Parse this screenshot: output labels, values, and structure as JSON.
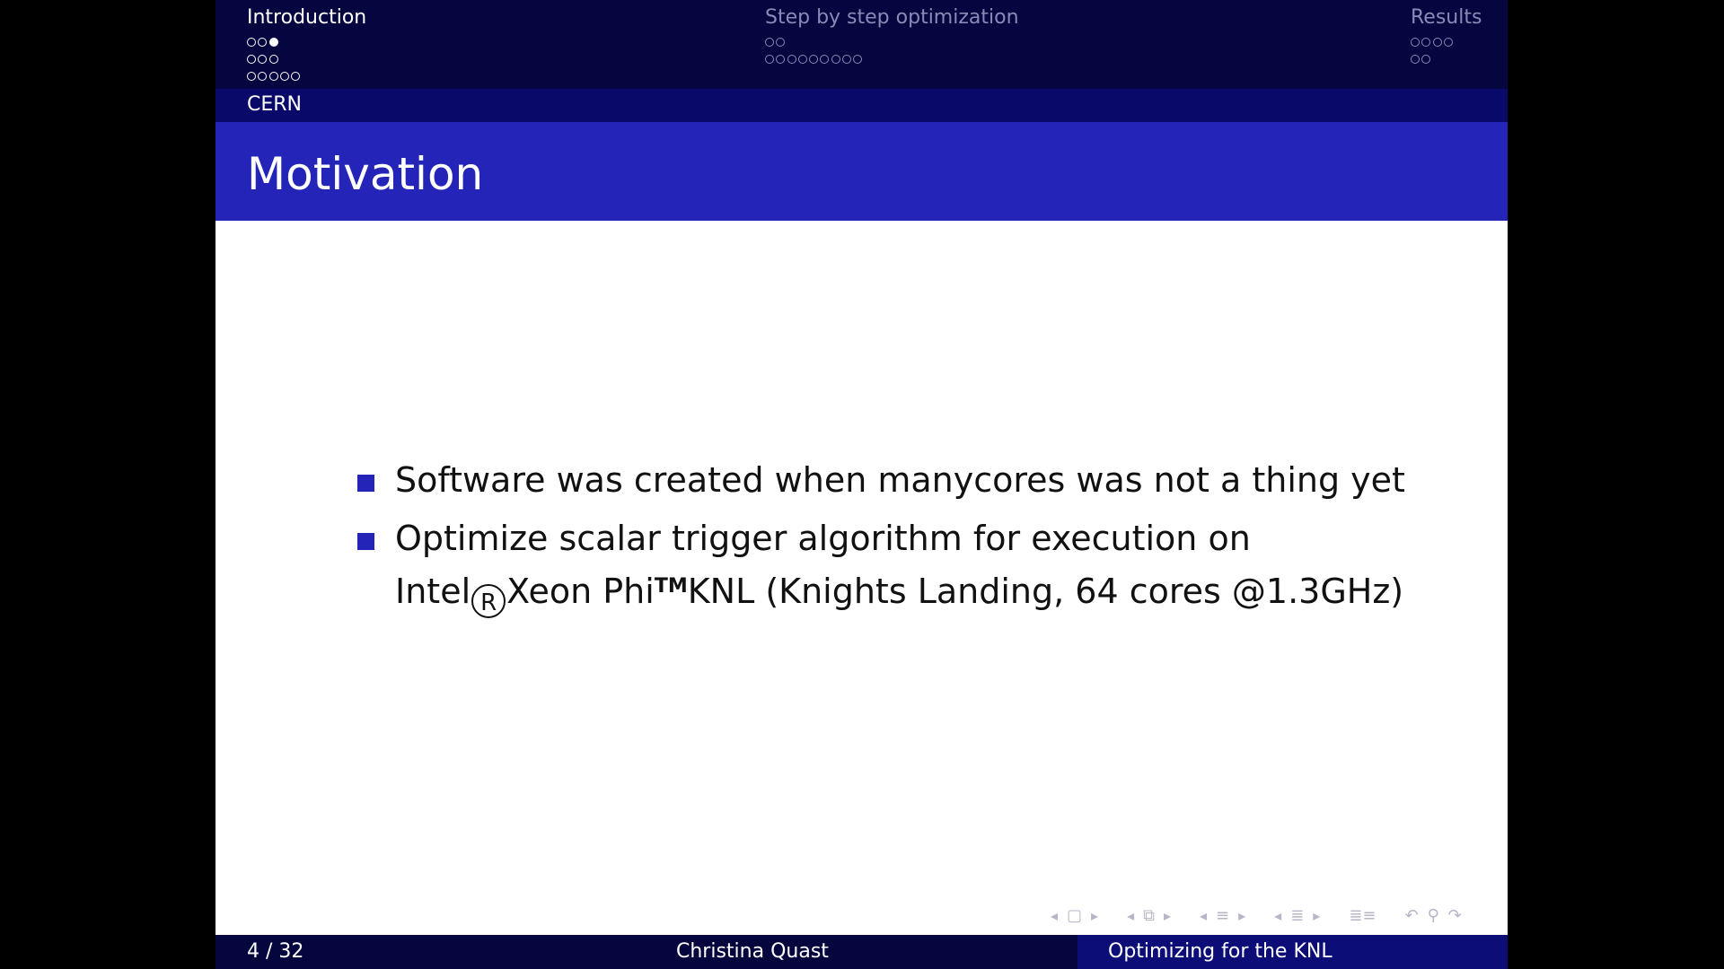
{
  "header": {
    "sections": [
      {
        "title": "Introduction",
        "current": true,
        "rows": [
          [
            0,
            0,
            1
          ],
          [
            0,
            0,
            0
          ],
          [
            0,
            0,
            0,
            0,
            0
          ]
        ]
      },
      {
        "title": "Step by step optimization",
        "current": false,
        "rows": [
          [
            0,
            0
          ],
          [
            0,
            0,
            0,
            0,
            0,
            0,
            0,
            0,
            0
          ]
        ]
      },
      {
        "title": "Results",
        "current": false,
        "rows": [
          [
            0,
            0,
            0,
            0
          ],
          [
            0,
            0
          ]
        ]
      }
    ],
    "subsection": "CERN"
  },
  "frame_title": "Motivation",
  "bullets": {
    "item1": "Software was created when manycores was not a thing yet",
    "item2_line1": "Optimize scalar trigger algorithm for execution on",
    "item2_intel": "Intel",
    "item2_registered": "R",
    "item2_xeon": "Xeon Phi",
    "item2_tm": "TM",
    "item2_rest": "KNL (Knights Landing, 64 cores @1.3GHz)"
  },
  "navigation_symbols": [
    "frame-nav-icon",
    "slide-nav-icon",
    "subsection-nav-icon",
    "section-nav-icon",
    "toc-icon",
    "back-icon",
    "search-icon",
    "forward-icon"
  ],
  "footer": {
    "page": "4 / 32",
    "author": "Christina Quast",
    "title": "Optimizing for the KNL"
  },
  "colors": {
    "header_bg": "#05053f",
    "subsection_bg": "#09096a",
    "title_bg": "#2424b8",
    "bullet": "#2424b8",
    "footer_title_bg": "#0d0d78"
  }
}
